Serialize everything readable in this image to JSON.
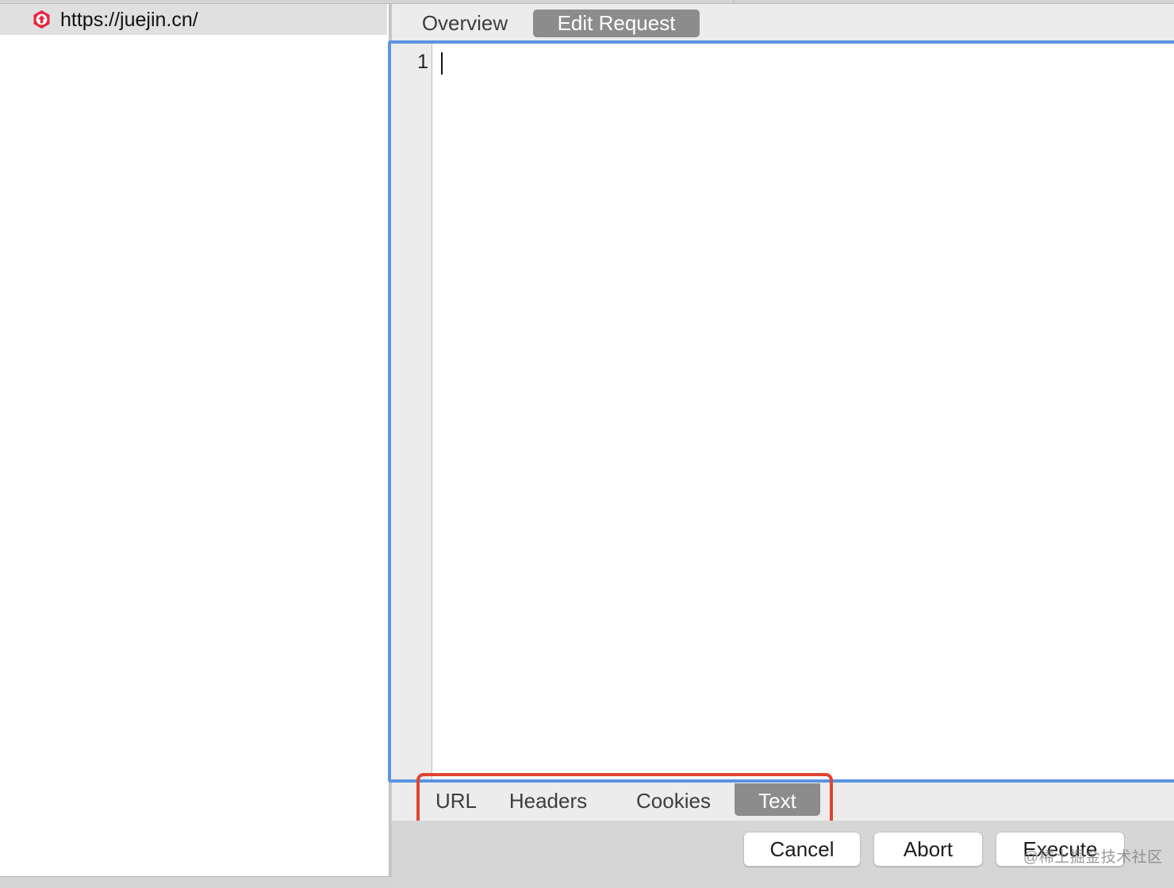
{
  "session": {
    "url": "https://juejin.cn/",
    "icon": "upload-arrow-icon",
    "icon_color": "#e8233f"
  },
  "tabs": [
    {
      "label": "Overview",
      "selected": false
    },
    {
      "label": "Edit Request",
      "selected": true
    }
  ],
  "editor": {
    "line_numbers": [
      "1"
    ],
    "content": ""
  },
  "sub_tabs": [
    {
      "label": "URL",
      "selected": false
    },
    {
      "label": "Headers",
      "selected": false
    },
    {
      "label": "Cookies",
      "selected": false
    },
    {
      "label": "Text",
      "selected": true
    }
  ],
  "buttons": {
    "cancel": "Cancel",
    "abort": "Abort",
    "execute": "Execute"
  },
  "watermark": "@稀土掘金技术社区",
  "colors": {
    "focus_ring": "#5b94e2",
    "highlight": "#e24331",
    "selected_tab": "#8c8c8c"
  }
}
